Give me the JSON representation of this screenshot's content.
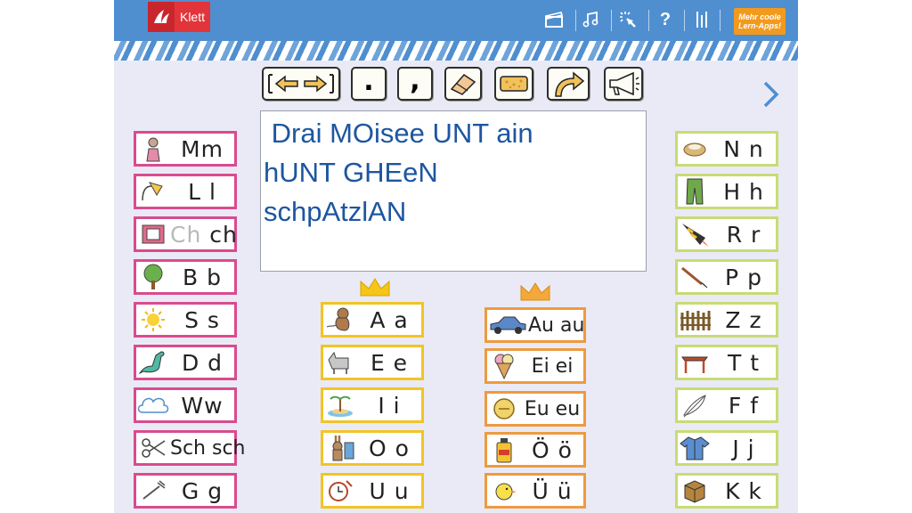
{
  "header": {
    "logo_text": "Klett",
    "icons": [
      "clapperboard-icon",
      "music-note-icon",
      "tap-icon",
      "help-icon",
      "settings-icon"
    ],
    "mehr_line1": "Mehr coole",
    "mehr_line2": "Lern-Apps!"
  },
  "toolbar": {
    "tools": [
      "space-arrows-icon",
      "period-icon",
      "comma-icon",
      "eraser-icon",
      "sponge-icon",
      "return-arrow-icon",
      "megaphone-icon"
    ],
    "period": ".",
    "comma": ","
  },
  "text_area": {
    "lines": [
      " Drai MOisee UNT ain",
      "hUNT GHEeN",
      "schpAtzlAN"
    ]
  },
  "left_column": [
    {
      "label": "Mm",
      "icon": "mouse-icon"
    },
    {
      "label": "L l",
      "icon": "lamp-icon"
    },
    {
      "label_gray": "Ch",
      "label": " ch",
      "icon": "book-icon"
    },
    {
      "label": "B b",
      "icon": "tree-icon"
    },
    {
      "label": "S s",
      "icon": "sun-icon"
    },
    {
      "label": "D d",
      "icon": "dinosaur-icon"
    },
    {
      "label": "Ww",
      "icon": "cloud-icon"
    },
    {
      "label": "Sch sch",
      "icon": "scissors-icon"
    },
    {
      "label": "G g",
      "icon": "fork-icon"
    }
  ],
  "vowels": [
    {
      "label": "A a",
      "icon": "monkey-icon"
    },
    {
      "label": "E e",
      "icon": "donkey-icon"
    },
    {
      "label": "I i",
      "icon": "island-icon"
    },
    {
      "label": "O o",
      "icon": "rabbit-icon"
    },
    {
      "label": "U u",
      "icon": "clock-icon"
    }
  ],
  "diphthongs": [
    {
      "label": "Au au",
      "icon": "car-icon"
    },
    {
      "label": "Ei ei",
      "icon": "ice-cream-icon"
    },
    {
      "label": "Eu eu",
      "icon": "coin-icon"
    },
    {
      "label": "Ö ö",
      "icon": "oil-can-icon"
    },
    {
      "label": "Ü ü",
      "icon": "chick-icon"
    }
  ],
  "right_column": [
    {
      "label": "N n",
      "icon": "nest-icon"
    },
    {
      "label": "H h",
      "icon": "trousers-icon"
    },
    {
      "label": "R r",
      "icon": "rocket-icon"
    },
    {
      "label": "P p",
      "icon": "brush-icon"
    },
    {
      "label": "Z z",
      "icon": "fence-icon"
    },
    {
      "label": "T t",
      "icon": "table-icon"
    },
    {
      "label": "F f",
      "icon": "feather-icon"
    },
    {
      "label": "J j",
      "icon": "jacket-icon"
    },
    {
      "label": "K k",
      "icon": "crate-icon"
    }
  ],
  "colors": {
    "header_blue": "#4f8fd0",
    "text_blue": "#1d56a0",
    "consonant_left": "#d94b8e",
    "consonant_right": "#c7dc74",
    "vowel": "#f2c425",
    "diphthong": "#ee9a40",
    "orange_button": "#f29a1d"
  }
}
